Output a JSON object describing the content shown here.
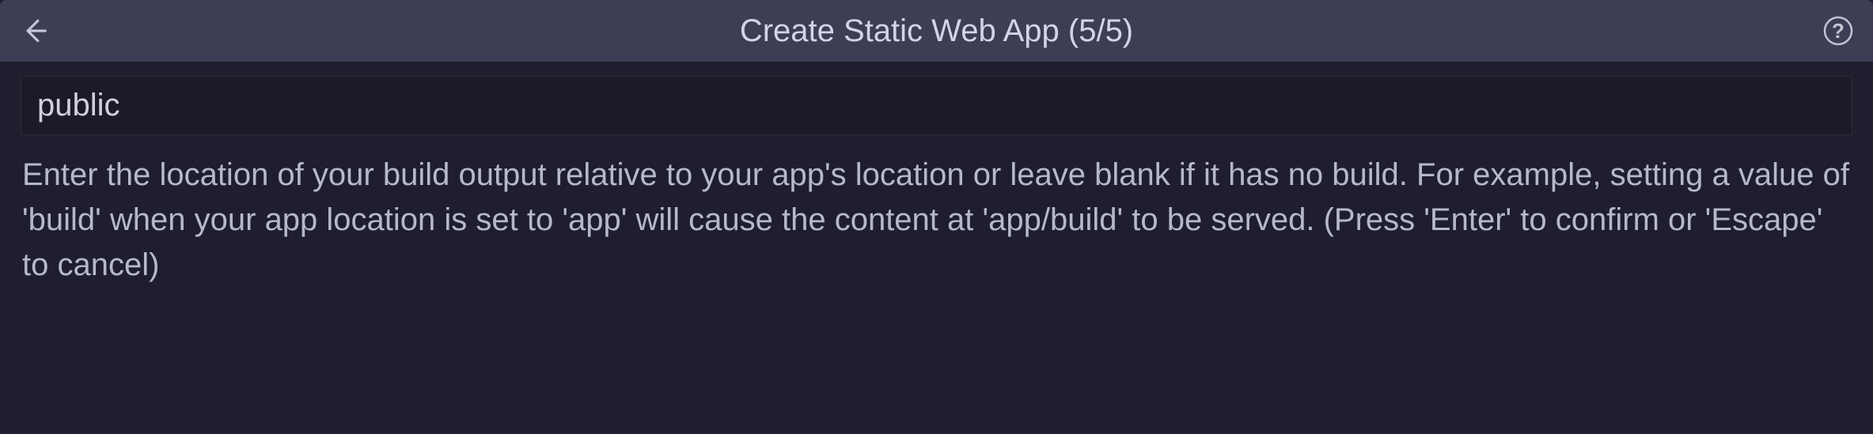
{
  "header": {
    "title": "Create Static Web App (5/5)"
  },
  "input": {
    "value": "public",
    "placeholder": ""
  },
  "description": "Enter the location of your build output relative to your app's location or leave blank if it has no build. For example, setting a value of 'build' when your app location is set to 'app' will cause the content at 'app/build' to be served. (Press 'Enter' to confirm or 'Escape' to cancel)"
}
